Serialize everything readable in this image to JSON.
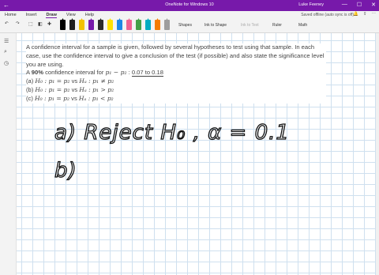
{
  "window": {
    "title": "OneNote for Windows 10",
    "user": "Luke Feeney",
    "back_icon": "←",
    "controls": [
      "—",
      "☐",
      "✕"
    ]
  },
  "menu": {
    "tabs": [
      "Home",
      "Insert",
      "Draw",
      "View",
      "Help"
    ],
    "active_tab": "Draw",
    "status": "Saved offline (auto sync is off)"
  },
  "toolbar": {
    "undo": "↶",
    "redo": "↷",
    "pen_colors": [
      "#000000",
      "#1f1f1f",
      "#f2c200",
      "#7719aa",
      "#2a2a2a",
      "#ffe100",
      "#1e88e5",
      "#f06292",
      "#43a047",
      "#00acc1",
      "#f57c00",
      "#9e9e9e"
    ],
    "shapes_label": "Shapes",
    "ink_to_shape_label": "Ink to Shape",
    "ink_to_text_label": "Ink to Text",
    "ruler_label": "Ruler",
    "math_label": "Math"
  },
  "problem": {
    "intro": "A confidence interval for a sample is given, followed by several hypotheses to test using that sample. In each case, use the confidence interval to give a conclusion of the test (if possible) and also state the significance level you are using.",
    "ci_prefix": "A ",
    "ci_percent": "90%",
    "ci_mid": " confidence interval for ",
    "ci_param": "p₁ − p₂",
    "ci_colon": " : ",
    "ci_range": "0.07 to 0.18",
    "hypotheses": [
      {
        "label": "(a) ",
        "h0": "H₀ : p₁ = p₂",
        "vs": " vs ",
        "ha": "Hₐ : p₁ ≠ p₂"
      },
      {
        "label": "(b) ",
        "h0": "H₀ : p₁ = p₂",
        "vs": " vs ",
        "ha": "Hₐ : p₁ > p₂"
      },
      {
        "label": "(c) ",
        "h0": "H₀ : p₁ = p₂",
        "vs": " vs ",
        "ha": "Hₐ : p₁ < p₂"
      }
    ]
  },
  "handwriting": {
    "line1": "a) Reject H₀ , α = 0.1",
    "line2": "b)"
  }
}
